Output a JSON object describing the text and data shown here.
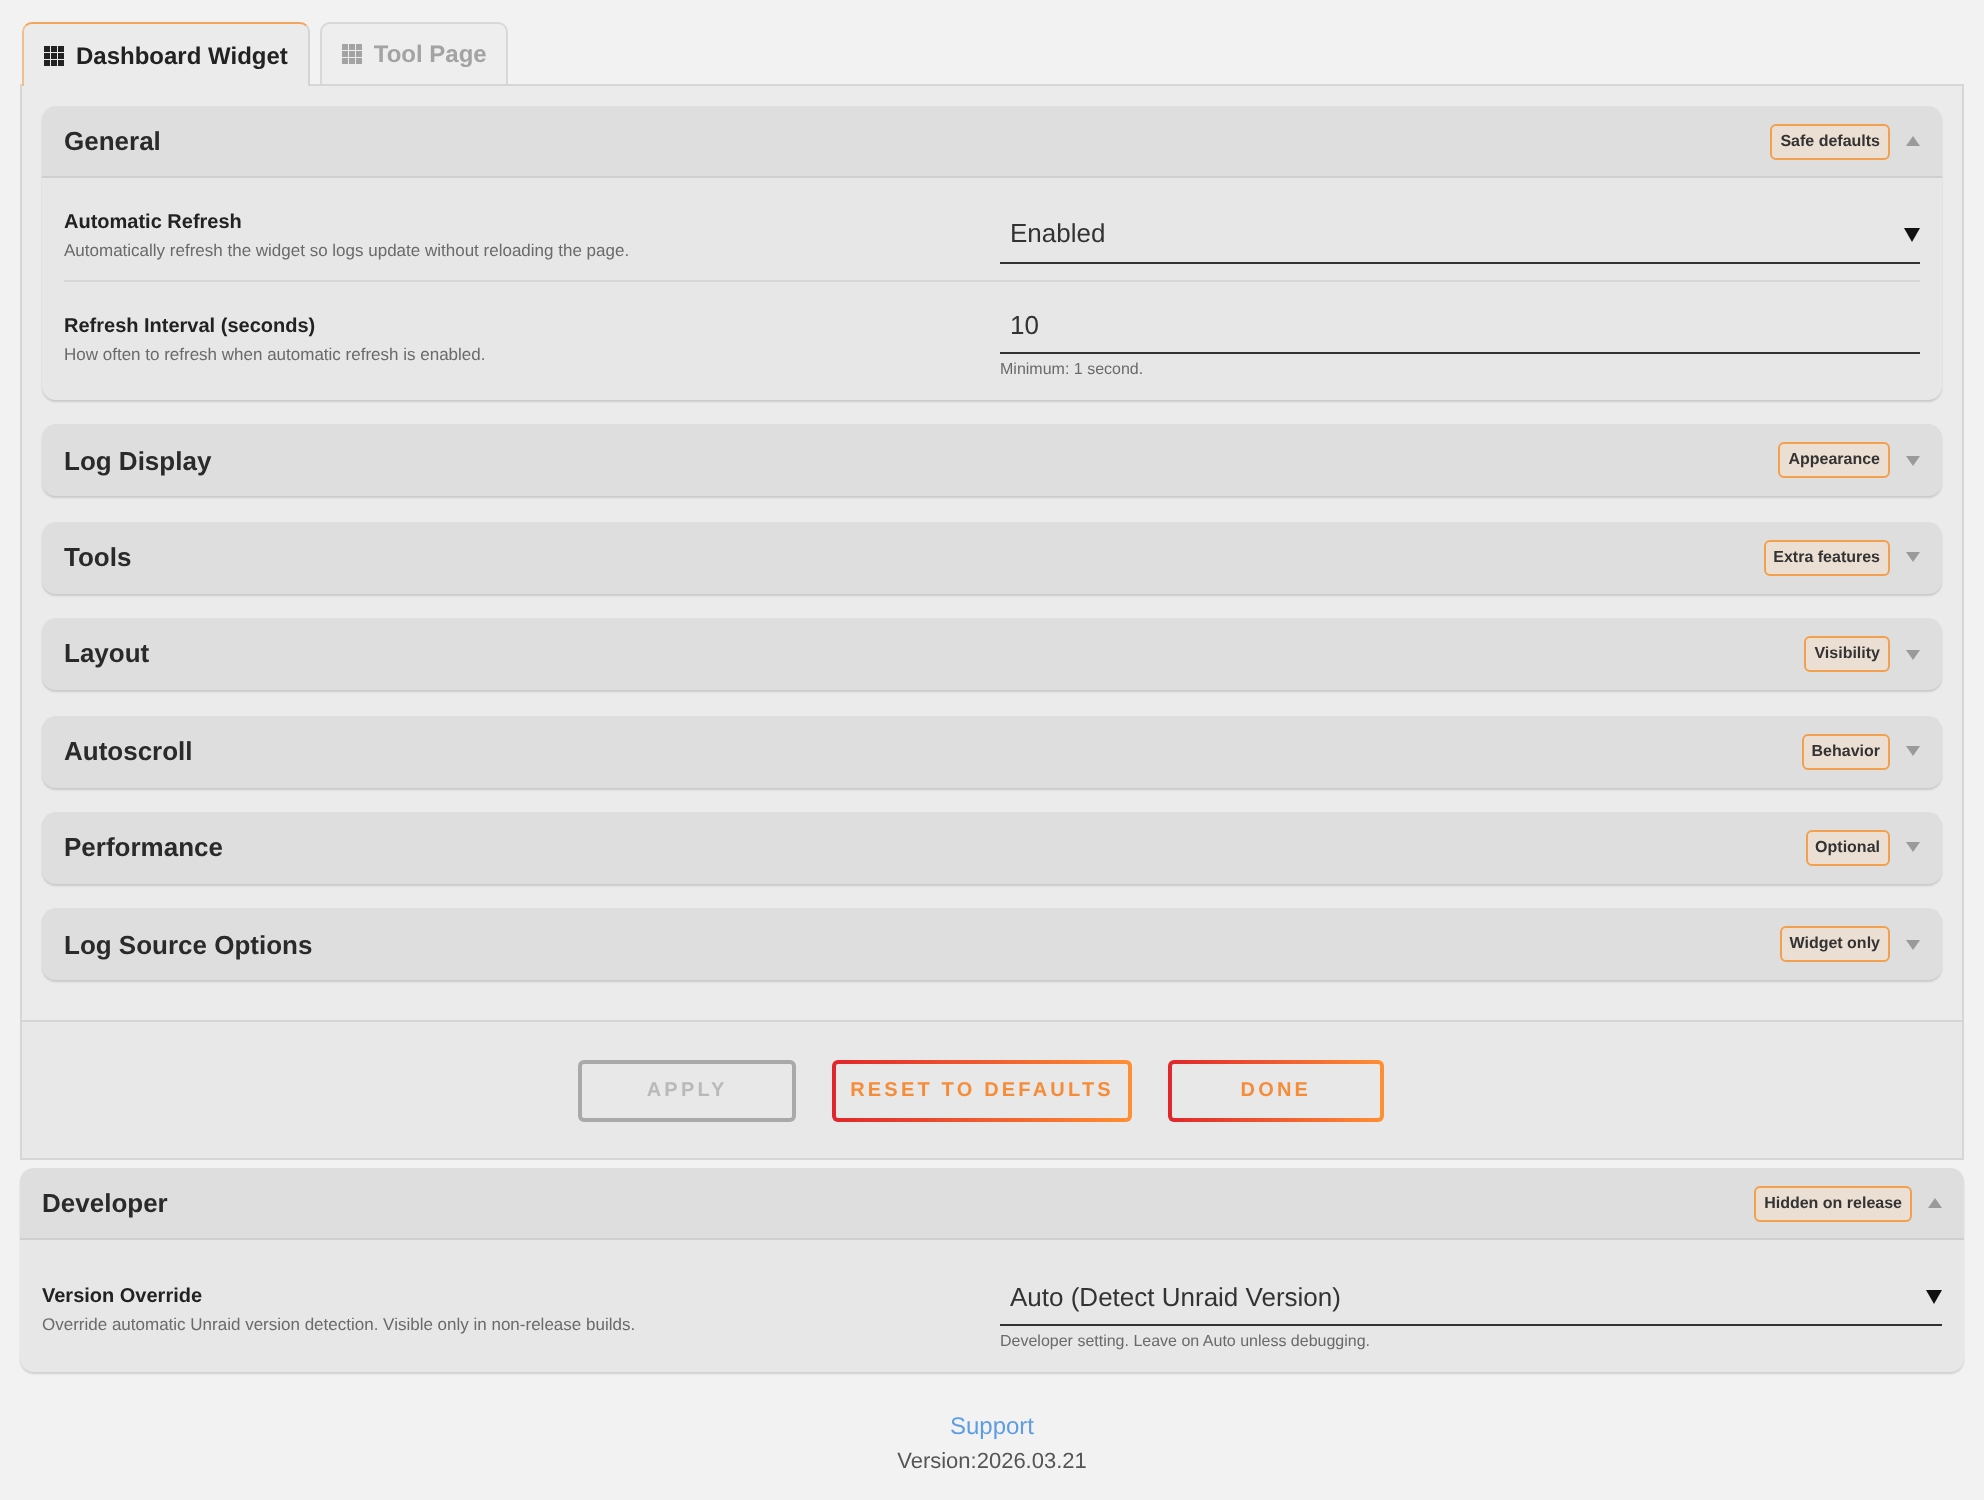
{
  "tabs": [
    {
      "label": "Dashboard Widget",
      "selected": true
    },
    {
      "label": "Tool Page",
      "selected": false
    }
  ],
  "sections": [
    {
      "title": "General",
      "badge": "Safe defaults",
      "expanded": true,
      "settings": [
        {
          "kind": "select",
          "label": "Automatic Refresh",
          "description": "Automatically refresh the widget so logs update without reloading the page.",
          "value": "Enabled"
        },
        {
          "kind": "input",
          "label": "Refresh Interval (seconds)",
          "description": "How often to refresh when automatic refresh is enabled.",
          "value": "10",
          "hint": "Minimum: 1 second."
        }
      ]
    },
    {
      "title": "Log Display",
      "badge": "Appearance",
      "expanded": false
    },
    {
      "title": "Tools",
      "badge": "Extra features",
      "expanded": false
    },
    {
      "title": "Layout",
      "badge": "Visibility",
      "expanded": false
    },
    {
      "title": "Autoscroll",
      "badge": "Behavior",
      "expanded": false
    },
    {
      "title": "Performance",
      "badge": "Optional",
      "expanded": false
    },
    {
      "title": "Log Source Options",
      "badge": "Widget only",
      "expanded": false
    }
  ],
  "buttons": [
    {
      "label": "APPLY",
      "disabled": true
    },
    {
      "label": "RESET TO DEFAULTS",
      "disabled": false
    },
    {
      "label": "DONE",
      "disabled": false
    }
  ],
  "developer": {
    "title": "Developer",
    "badge": "Hidden on release",
    "expanded": true,
    "settings": [
      {
        "kind": "select",
        "label": "Version Override",
        "description": "Override automatic Unraid version detection. Visible only in non-release builds.",
        "value": "Auto (Detect Unraid Version)",
        "hint": "Developer setting. Leave on Auto unless debugging."
      }
    ]
  },
  "footer": {
    "link": "Support",
    "version": "Version:2026.03.21"
  }
}
